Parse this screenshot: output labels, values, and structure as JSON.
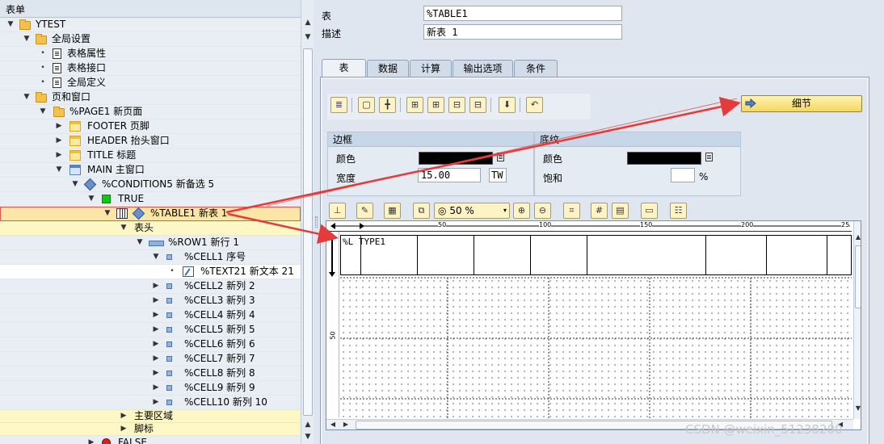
{
  "tree": {
    "header": "表单",
    "rows": [
      {
        "label": "YTEST"
      },
      {
        "label": "全局设置"
      },
      {
        "label": "表格属性"
      },
      {
        "label": "表格接口"
      },
      {
        "label": "全局定义"
      },
      {
        "label": "页和窗口"
      },
      {
        "label": "%PAGE1 新页面"
      },
      {
        "label": "FOOTER 页脚"
      },
      {
        "label": "HEADER 抬头窗口"
      },
      {
        "label": "TITLE 标题"
      },
      {
        "label": "MAIN 主窗口"
      },
      {
        "label": "%CONDITION5 新备选 5"
      },
      {
        "label": "TRUE"
      },
      {
        "label": "%TABLE1 新表 1"
      },
      {
        "label": "表头"
      },
      {
        "label": "%ROW1 新行 1"
      },
      {
        "label": "%CELL1 序号"
      },
      {
        "label": "%TEXT21 新文本 21"
      },
      {
        "label": "%CELL2 新列 2"
      },
      {
        "label": "%CELL3 新列 3"
      },
      {
        "label": "%CELL4 新列 4"
      },
      {
        "label": "%CELL5 新列 5"
      },
      {
        "label": "%CELL6 新列 6"
      },
      {
        "label": "%CELL7 新列 7"
      },
      {
        "label": "%CELL8 新列 8"
      },
      {
        "label": "%CELL9 新列 9"
      },
      {
        "label": "%CELL10 新列 10"
      },
      {
        "label": "主要区域"
      },
      {
        "label": "脚标"
      },
      {
        "label": "FALSE"
      }
    ]
  },
  "form": {
    "table_label": "表",
    "table_value": "%TABLE1",
    "desc_label": "描述",
    "desc_value": "新表 1"
  },
  "tabs": [
    {
      "label": "表"
    },
    {
      "label": "数据"
    },
    {
      "label": "计算"
    },
    {
      "label": "输出选项"
    },
    {
      "label": "条件"
    }
  ],
  "detail_button": "细节",
  "border_group": {
    "title": "边框",
    "color_label": "颜色",
    "width_label": "宽度",
    "width_value": "15.00",
    "unit_value": "TW"
  },
  "shading_group": {
    "title": "底纹",
    "color_label": "颜色",
    "saturation_label": "饱和",
    "saturation_value": "",
    "percent": "%"
  },
  "zoom": "50 %",
  "ruler": {
    "ticks": [
      "50",
      "100",
      "150",
      "200",
      "25"
    ],
    "v_tick": "50"
  },
  "canvas": {
    "line_type": "%L TYPE1"
  },
  "watermark": "CSDN @weixin_51238200",
  "colors": {
    "highlight_red": "#e53b3b",
    "selected_row": "#fbe6a8",
    "yellow_row": "#fdf7c6"
  },
  "icons": {
    "tree_toggle_open": "▼",
    "tree_toggle_closed": "▶",
    "bullet": "•",
    "scroll_up": "▲",
    "scroll_down": "▼",
    "scroll_left": "◀",
    "scroll_right": "▶"
  }
}
